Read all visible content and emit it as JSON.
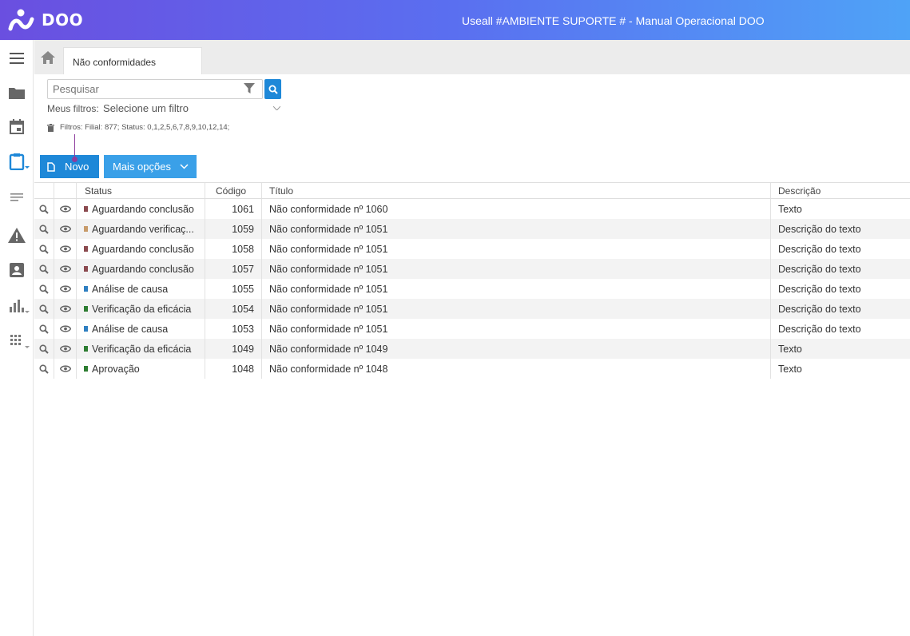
{
  "header": {
    "logo_text": "DOO",
    "env_title": "Useall #AMBIENTE SUPORTE # - Manual Operacional DOO"
  },
  "tabs": [
    {
      "label": "Não conformidades"
    }
  ],
  "search": {
    "placeholder": "Pesquisar",
    "my_filters_label": "Meus filtros:",
    "my_filters_value": "Selecione um filtro",
    "active_filters": "Filtros: Filial: 877; Status: 0,1,2,5,6,7,8,9,10,12,14;"
  },
  "toolbar": {
    "new_label": "Novo",
    "more_label": "Mais opções"
  },
  "grid": {
    "columns": [
      "Status",
      "Código",
      "Título",
      "Descrição"
    ],
    "status_colors": {
      "Aguardando conclusão": "#8b4a4f",
      "Aguardando verificação": "#c89b6a",
      "Análise de causa": "#2f7fc1",
      "Verificação da eficácia": "#2e7d32",
      "Aprovação": "#2e7d32"
    },
    "rows": [
      {
        "status": "Aguardando conclusão",
        "color": "#8b4a4f",
        "code": "1061",
        "title": "Não conformidade nº 1060",
        "desc": "Texto"
      },
      {
        "status": "Aguardando verificaç...",
        "color": "#c89b6a",
        "code": "1059",
        "title": "Não conformidade nº 1051",
        "desc": "Descrição do texto"
      },
      {
        "status": "Aguardando conclusão",
        "color": "#8b4a4f",
        "code": "1058",
        "title": "Não conformidade nº 1051",
        "desc": "Descrição do texto"
      },
      {
        "status": "Aguardando conclusão",
        "color": "#8b4a4f",
        "code": "1057",
        "title": "Não conformidade nº 1051",
        "desc": "Descrição do texto"
      },
      {
        "status": "Análise de causa",
        "color": "#2f7fc1",
        "code": "1055",
        "title": "Não conformidade nº 1051",
        "desc": "Descrição do texto"
      },
      {
        "status": "Verificação da eficácia",
        "color": "#2e7d32",
        "code": "1054",
        "title": "Não conformidade nº 1051",
        "desc": "Descrição do texto"
      },
      {
        "status": "Análise de causa",
        "color": "#2f7fc1",
        "code": "1053",
        "title": "Não conformidade nº 1051",
        "desc": "Descrição do texto"
      },
      {
        "status": "Verificação da eficácia",
        "color": "#2e7d32",
        "code": "1049",
        "title": "Não conformidade nº 1049",
        "desc": "Texto"
      },
      {
        "status": "Aprovação",
        "color": "#2e7d32",
        "code": "1048",
        "title": "Não conformidade nº 1048",
        "desc": "Texto"
      }
    ]
  },
  "sidebar": {
    "items": [
      {
        "icon": "menu-icon"
      },
      {
        "icon": "folder-icon"
      },
      {
        "icon": "calendar-icon"
      },
      {
        "icon": "clipboard-icon",
        "active": true
      },
      {
        "icon": "list-icon"
      },
      {
        "icon": "warning-icon"
      },
      {
        "icon": "contact-card-icon"
      },
      {
        "icon": "bar-chart-icon"
      },
      {
        "icon": "apps-grid-icon"
      }
    ]
  }
}
